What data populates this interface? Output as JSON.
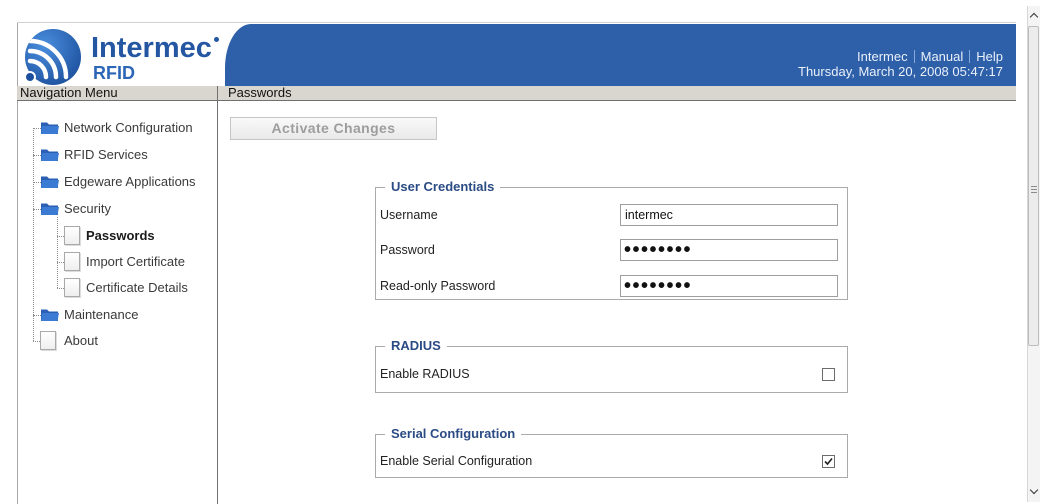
{
  "theme": {
    "banner": "#2e5fa9",
    "logo_blue": "#2456a2",
    "legend_blue": "#2a4b84",
    "bar_gray": "#d9d6cf",
    "folder_blue": "#2f6cc4"
  },
  "header": {
    "logo": {
      "name": "Intermec",
      "product": "RFID",
      "icon": "intermec-wave-logo"
    },
    "links": [
      {
        "label": "Intermec"
      },
      {
        "label": "Manual"
      },
      {
        "label": "Help"
      }
    ],
    "datetime": "Thursday, March 20, 2008 05:47:17"
  },
  "bar": {
    "nav_title": "Navigation Menu",
    "page_title": "Passwords"
  },
  "nav": {
    "items": [
      {
        "label": "Network Configuration",
        "icon": "folder-icon",
        "level": 1
      },
      {
        "label": "RFID Services",
        "icon": "folder-icon",
        "level": 1
      },
      {
        "label": "Edgeware Applications",
        "icon": "folder-icon",
        "level": 1
      },
      {
        "label": "Security",
        "icon": "folder-icon",
        "level": 1,
        "expanded": true
      },
      {
        "label": "Passwords",
        "icon": "page-icon",
        "level": 2,
        "selected": true
      },
      {
        "label": "Import Certificate",
        "icon": "page-icon",
        "level": 2,
        "selected": false
      },
      {
        "label": "Certificate Details",
        "icon": "page-icon",
        "level": 2,
        "selected": false
      },
      {
        "label": "Maintenance",
        "icon": "folder-icon",
        "level": 1
      },
      {
        "label": "About",
        "icon": "page-icon",
        "level": 1
      }
    ]
  },
  "main": {
    "activate_button": {
      "label": "Activate Changes",
      "enabled": false
    },
    "user_credentials": {
      "legend": "User Credentials",
      "fields": [
        {
          "label": "Username",
          "value": "intermec"
        },
        {
          "label": "Password",
          "value": "••••••••"
        },
        {
          "label": "Read-only Password",
          "value": "••••••••"
        }
      ]
    },
    "radius": {
      "legend": "RADIUS",
      "label": "Enable RADIUS",
      "checked": false
    },
    "serial": {
      "legend": "Serial Configuration",
      "label": "Enable Serial Configuration",
      "checked": true
    }
  }
}
